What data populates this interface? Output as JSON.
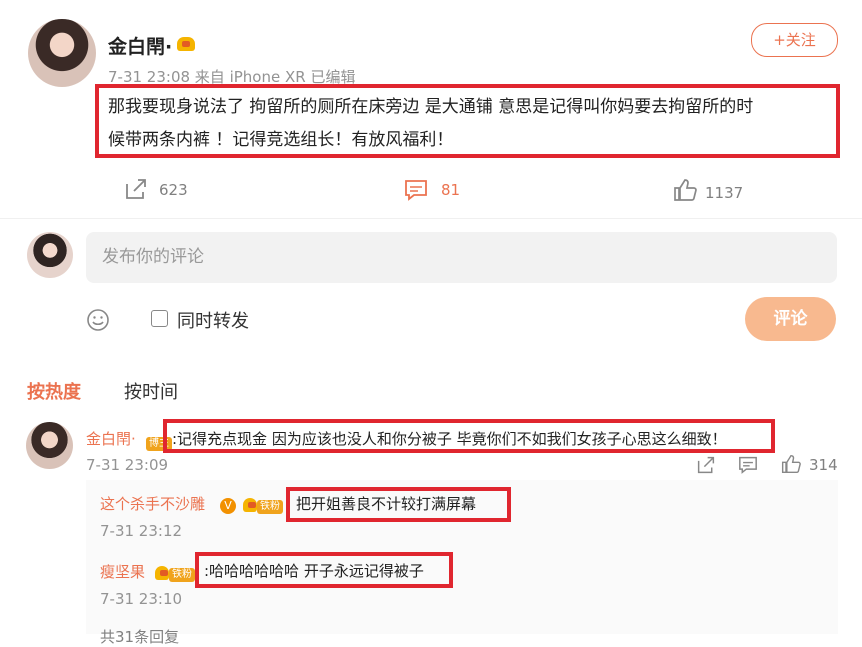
{
  "post": {
    "author": "金白閈·",
    "meta": "7-31 23:08 来自 iPhone XR 已编辑",
    "follow_label": "+关注",
    "content_line1": "那我要现身说法了 拘留所的厕所在床旁边 是大通铺 意思是记得叫你妈要去拘留所的时",
    "content_line2": "候带两条内裤 ！记得竞选组长！有放风福利！",
    "share_count": "623",
    "comment_count": "81",
    "like_count": "1137"
  },
  "composer": {
    "placeholder": "发布你的评论",
    "repost_label": "同时转发",
    "submit_label": "评论"
  },
  "sort": {
    "hot_label": "按热度",
    "time_label": "按时间"
  },
  "comments": [
    {
      "author": "金白閈·",
      "badge": "博主",
      "text": ":记得充点现金 因为应该也没人和你分被子 毕竟你们不如我们女孩子心思这么细致！",
      "time": "7-31 23:09",
      "like_count": "314"
    }
  ],
  "replies": [
    {
      "author": "这个杀手不沙雕",
      "vbadge": "V",
      "badge": "铁粉",
      "text": "把开姐善良不计较打满屏幕",
      "time": "7-31 23:12"
    },
    {
      "author": "瘦坚果",
      "badge": "铁粉",
      "text": ":哈哈哈哈哈哈 开子永远记得被子",
      "time": "7-31 23:10"
    }
  ],
  "more_replies": "共31条回复",
  "colors": {
    "accent": "#eb7350",
    "highlight": "#e0262f",
    "muted": "#939393"
  }
}
